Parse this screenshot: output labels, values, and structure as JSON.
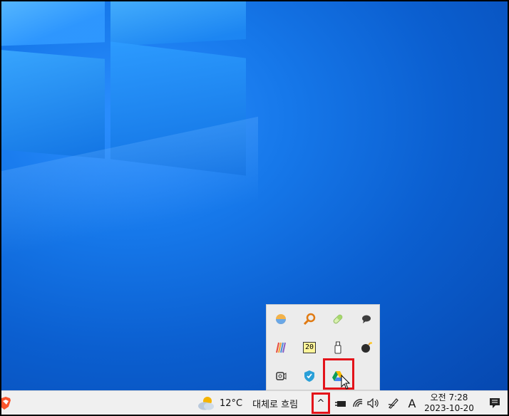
{
  "taskbar": {
    "weather": {
      "temperature": "12°C",
      "condition": "대체로 흐림"
    },
    "show_hidden_icons": "^",
    "ime_indicator": "A",
    "clock": {
      "time": "오전 7:28",
      "date": "2023-10-20"
    }
  },
  "tray_overflow": {
    "icons": [
      {
        "name": "color-sphere-icon"
      },
      {
        "name": "search-key-icon"
      },
      {
        "name": "pill-icon"
      },
      {
        "name": "chat-bubble-icon"
      },
      {
        "name": "colored-stripes-icon"
      },
      {
        "name": "calendar-badge-icon",
        "label": "20"
      },
      {
        "name": "usb-drive-icon"
      },
      {
        "name": "bomb-icon"
      },
      {
        "name": "webcam-icon"
      },
      {
        "name": "shield-icon"
      },
      {
        "name": "google-drive-icon"
      }
    ]
  },
  "colors": {
    "highlight": "#e3131a",
    "taskbar_bg": "#f0f0f0",
    "desktop_blue": "#0a62d0"
  }
}
